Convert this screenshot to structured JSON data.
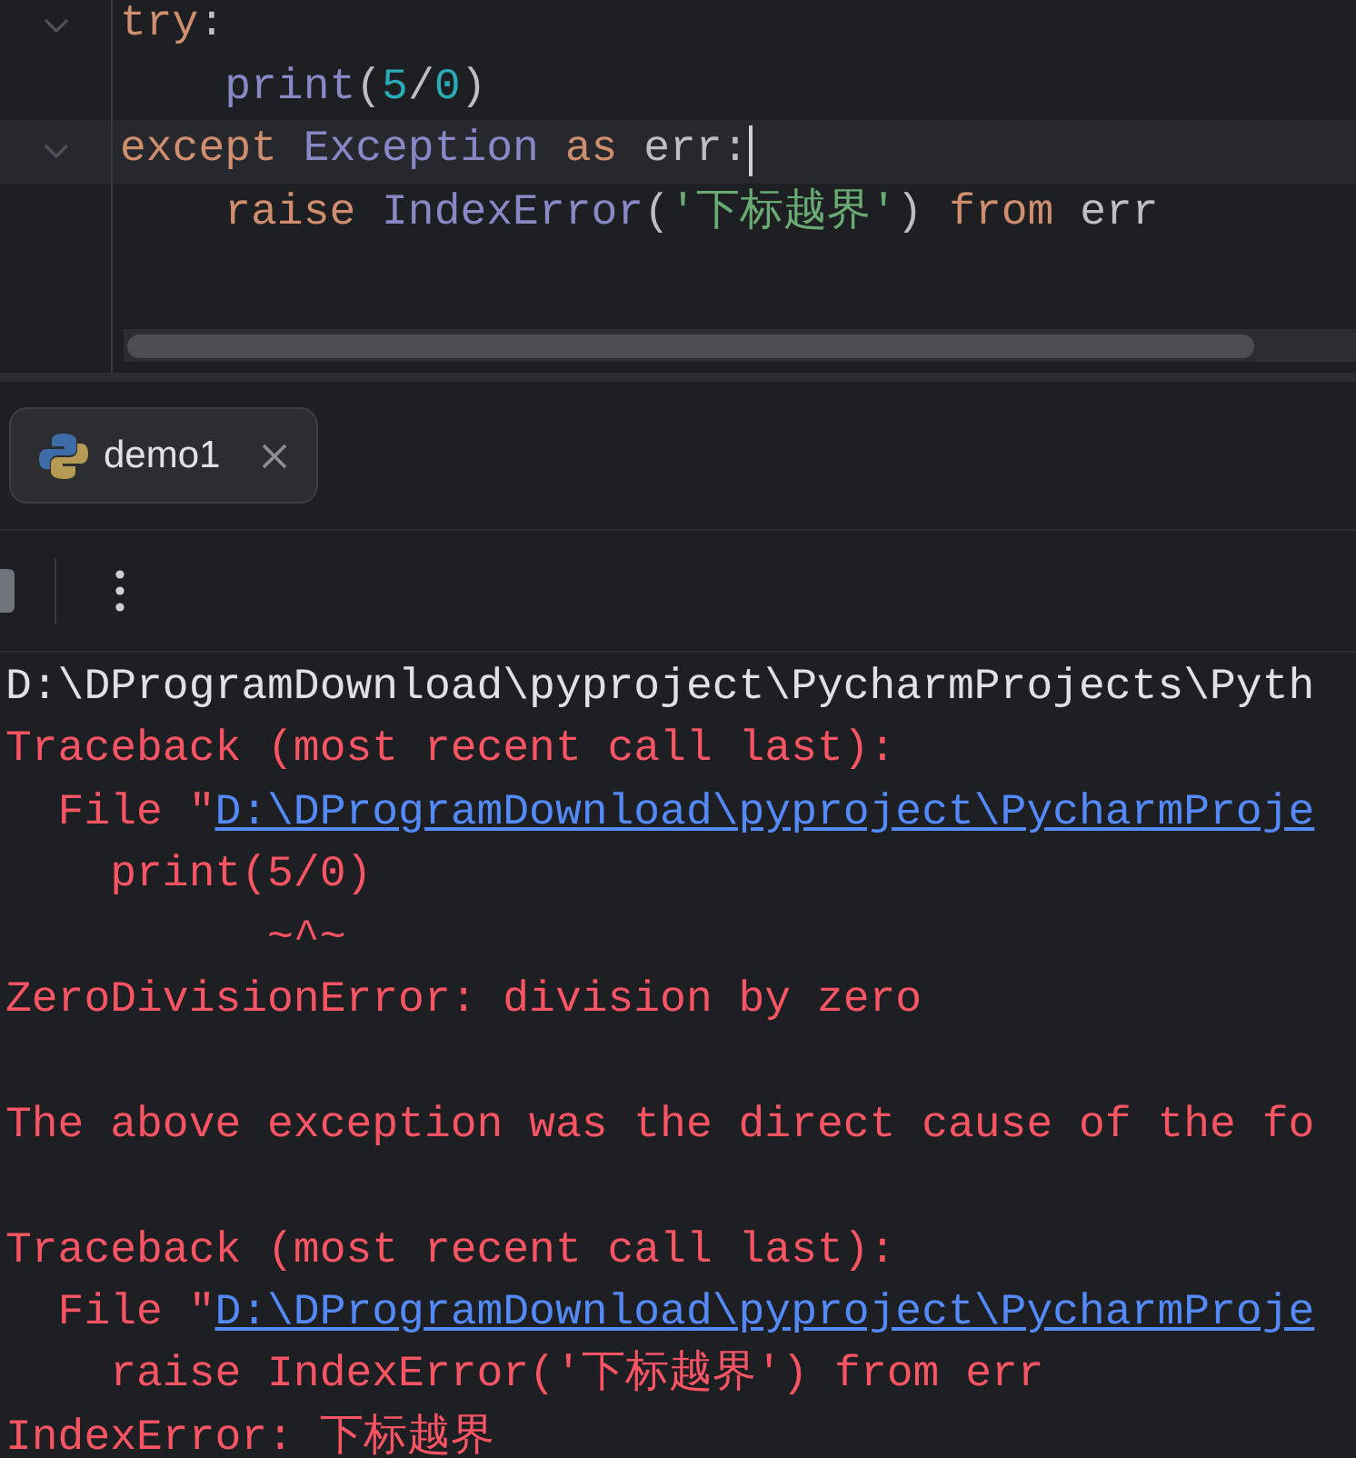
{
  "editor": {
    "lines": [
      {
        "fold": true,
        "current": false,
        "caret": false,
        "tokens": [
          {
            "kind": "keyword",
            "text": "try"
          },
          {
            "kind": "plain",
            "text": ":"
          }
        ]
      },
      {
        "fold": false,
        "current": false,
        "caret": false,
        "tokens": [
          {
            "kind": "builtin",
            "text": "    print"
          },
          {
            "kind": "plain",
            "text": "("
          },
          {
            "kind": "number",
            "text": "5"
          },
          {
            "kind": "plain",
            "text": "/"
          },
          {
            "kind": "number",
            "text": "0"
          },
          {
            "kind": "plain",
            "text": ")"
          }
        ]
      },
      {
        "fold": true,
        "current": true,
        "caret": true,
        "tokens": [
          {
            "kind": "keyword",
            "text": "except"
          },
          {
            "kind": "builtin",
            "text": " Exception"
          },
          {
            "kind": "keyword",
            "text": " as"
          },
          {
            "kind": "plain",
            "text": " err:"
          }
        ]
      },
      {
        "fold": false,
        "current": false,
        "caret": false,
        "tokens": [
          {
            "kind": "keyword",
            "text": "    raise"
          },
          {
            "kind": "builtin",
            "text": " IndexError"
          },
          {
            "kind": "plain",
            "text": "("
          },
          {
            "kind": "string",
            "text": "'下标越界'"
          },
          {
            "kind": "plain",
            "text": ")"
          },
          {
            "kind": "keyword",
            "text": " from"
          },
          {
            "kind": "plain",
            "text": " err"
          }
        ]
      }
    ]
  },
  "run_tabs": [
    {
      "label": "demo1",
      "selected": true,
      "closable": true
    }
  ],
  "console": {
    "lines": [
      {
        "kind": "text",
        "segments": [
          {
            "kind": "path",
            "text": "D:\\DProgramDownload\\pyproject\\PycharmProjects\\Pyth"
          }
        ]
      },
      {
        "kind": "text",
        "segments": [
          {
            "kind": "error",
            "text": "Traceback (most recent call last):"
          }
        ]
      },
      {
        "kind": "text",
        "segments": [
          {
            "kind": "error",
            "text": "  File \""
          },
          {
            "kind": "link",
            "text": "D:\\DProgramDownload\\pyproject\\PycharmProje"
          }
        ]
      },
      {
        "kind": "text",
        "segments": [
          {
            "kind": "error",
            "text": "    print(5/0)"
          }
        ]
      },
      {
        "kind": "text",
        "segments": [
          {
            "kind": "error",
            "text": "          ~^~"
          }
        ]
      },
      {
        "kind": "text",
        "segments": [
          {
            "kind": "error",
            "text": "ZeroDivisionError: division by zero"
          }
        ]
      },
      {
        "kind": "blank"
      },
      {
        "kind": "text",
        "segments": [
          {
            "kind": "error",
            "text": "The above exception was the direct cause of the fo"
          }
        ]
      },
      {
        "kind": "blank"
      },
      {
        "kind": "text",
        "segments": [
          {
            "kind": "error",
            "text": "Traceback (most recent call last):"
          }
        ]
      },
      {
        "kind": "text",
        "segments": [
          {
            "kind": "error",
            "text": "  File \""
          },
          {
            "kind": "link",
            "text": "D:\\DProgramDownload\\pyproject\\PycharmProje"
          }
        ]
      },
      {
        "kind": "text",
        "segments": [
          {
            "kind": "error",
            "text": "    raise IndexError('下标越界') from err"
          }
        ]
      },
      {
        "kind": "text",
        "segments": [
          {
            "kind": "error",
            "text": "IndexError: 下标越界"
          }
        ]
      }
    ]
  }
}
